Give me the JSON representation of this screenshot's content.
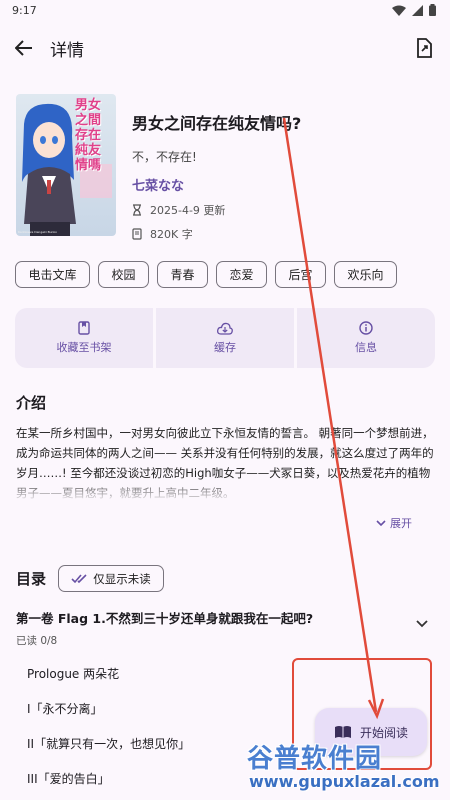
{
  "status": {
    "time": "9:17"
  },
  "topbar": {
    "title": "详情"
  },
  "book": {
    "title": "男女之间存在纯友情吗?",
    "subtitle": "不，不存在!",
    "author": "七菜なな",
    "updated": "2025-4-9 更新",
    "words": "820K 字",
    "cover_title": "男女之間存在純友情嗎",
    "cover_publisher": "Kadokawa Dengeki Bunko"
  },
  "tags": [
    "电击文库",
    "校园",
    "青春",
    "恋爱",
    "后宫",
    "欢乐向"
  ],
  "actions": [
    {
      "label": "收藏至书架",
      "icon": "bookmark-icon"
    },
    {
      "label": "缓存",
      "icon": "cloud-download-icon"
    },
    {
      "label": "信息",
      "icon": "info-icon"
    }
  ],
  "intro": {
    "heading": "介绍",
    "text": "在某一所乡村国中，一对男女向彼此立下永恒友情的誓言。 朝著同一个梦想前进，成为命运共同体的两人之间—— 关系并没有任何特别的发展，就这么度过了两年的岁月……! 至今都还没谈过初恋的High咖女子——犬冢日葵，以及热爱花卉的植物男子——夏目悠宇，就要升上高中二年级。",
    "expand_label": "展开"
  },
  "toc": {
    "heading": "目录",
    "filter_label": "仅显示未读",
    "volume": {
      "title": "第一卷 Flag 1.不然到三十岁还单身就跟我在一起吧?",
      "progress": "已读 0/8"
    },
    "chapters": [
      "Prologue 两朵花",
      "I「永不分离」",
      "II「就算只有一次，也想见你」",
      "III「爱的告白」"
    ]
  },
  "fab": {
    "label": "开始阅读"
  },
  "watermark": {
    "text": "谷普软件园",
    "url": "www.gupuxlazal.com"
  },
  "colors": {
    "accent": "#6750a4",
    "surface": "#fcf7fd",
    "tonal": "#f0e9f6",
    "annotation": "#e14b3b"
  }
}
